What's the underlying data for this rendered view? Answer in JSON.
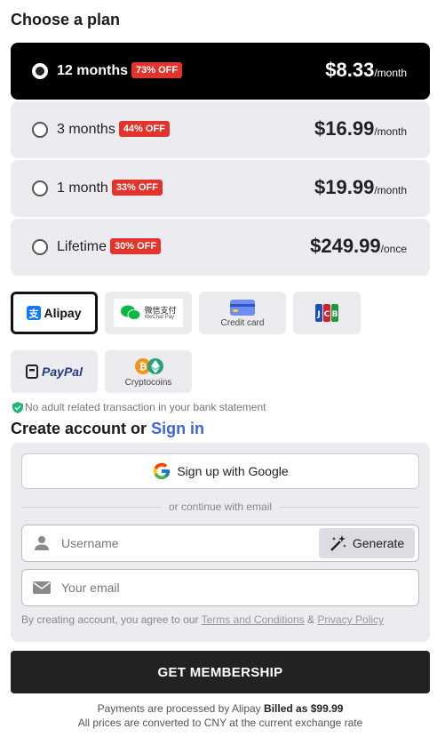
{
  "title": "Choose a plan",
  "plans": [
    {
      "name": "12 months",
      "badge": "73% OFF",
      "price": "$8.33",
      "per": "/month"
    },
    {
      "name": "3 months",
      "badge": "44% OFF",
      "price": "$16.99",
      "per": "/month"
    },
    {
      "name": "1 month",
      "badge": "33% OFF",
      "price": "$19.99",
      "per": "/month"
    },
    {
      "name": "Lifetime",
      "badge": "30% OFF",
      "price": "$249.99",
      "per": "/once"
    }
  ],
  "payments": {
    "alipay": "Alipay",
    "wechat_cn": "微信支付",
    "wechat_en": "WeChat Pay",
    "credit_card": "Credit card",
    "jcb": "JCB",
    "paypal": "PayPal",
    "crypto": "Cryptocoins"
  },
  "notice": "No adult related transaction in your bank statement",
  "account": {
    "title_prefix": "Create account or",
    "sign_in": "Sign in",
    "google": "Sign up with Google",
    "divider": "or continue with email",
    "username_placeholder": "Username",
    "generate": "Generate",
    "email_placeholder": "Your email",
    "terms_prefix": "By creating account, you agree to our",
    "terms_link": "Terms and Conditions",
    "amp": "&",
    "privacy_link": "Privacy Policy"
  },
  "cta": "GET MEMBERSHIP",
  "footer": {
    "processed_prefix": "Payments are processed by Alipay",
    "billed": "Billed as $99.99",
    "converted": "All prices are converted to CNY at the current exchange rate"
  },
  "colors": {
    "badge": "#e2342d",
    "link": "#3e63dd",
    "selected": "#000000",
    "cta": "#222222"
  }
}
